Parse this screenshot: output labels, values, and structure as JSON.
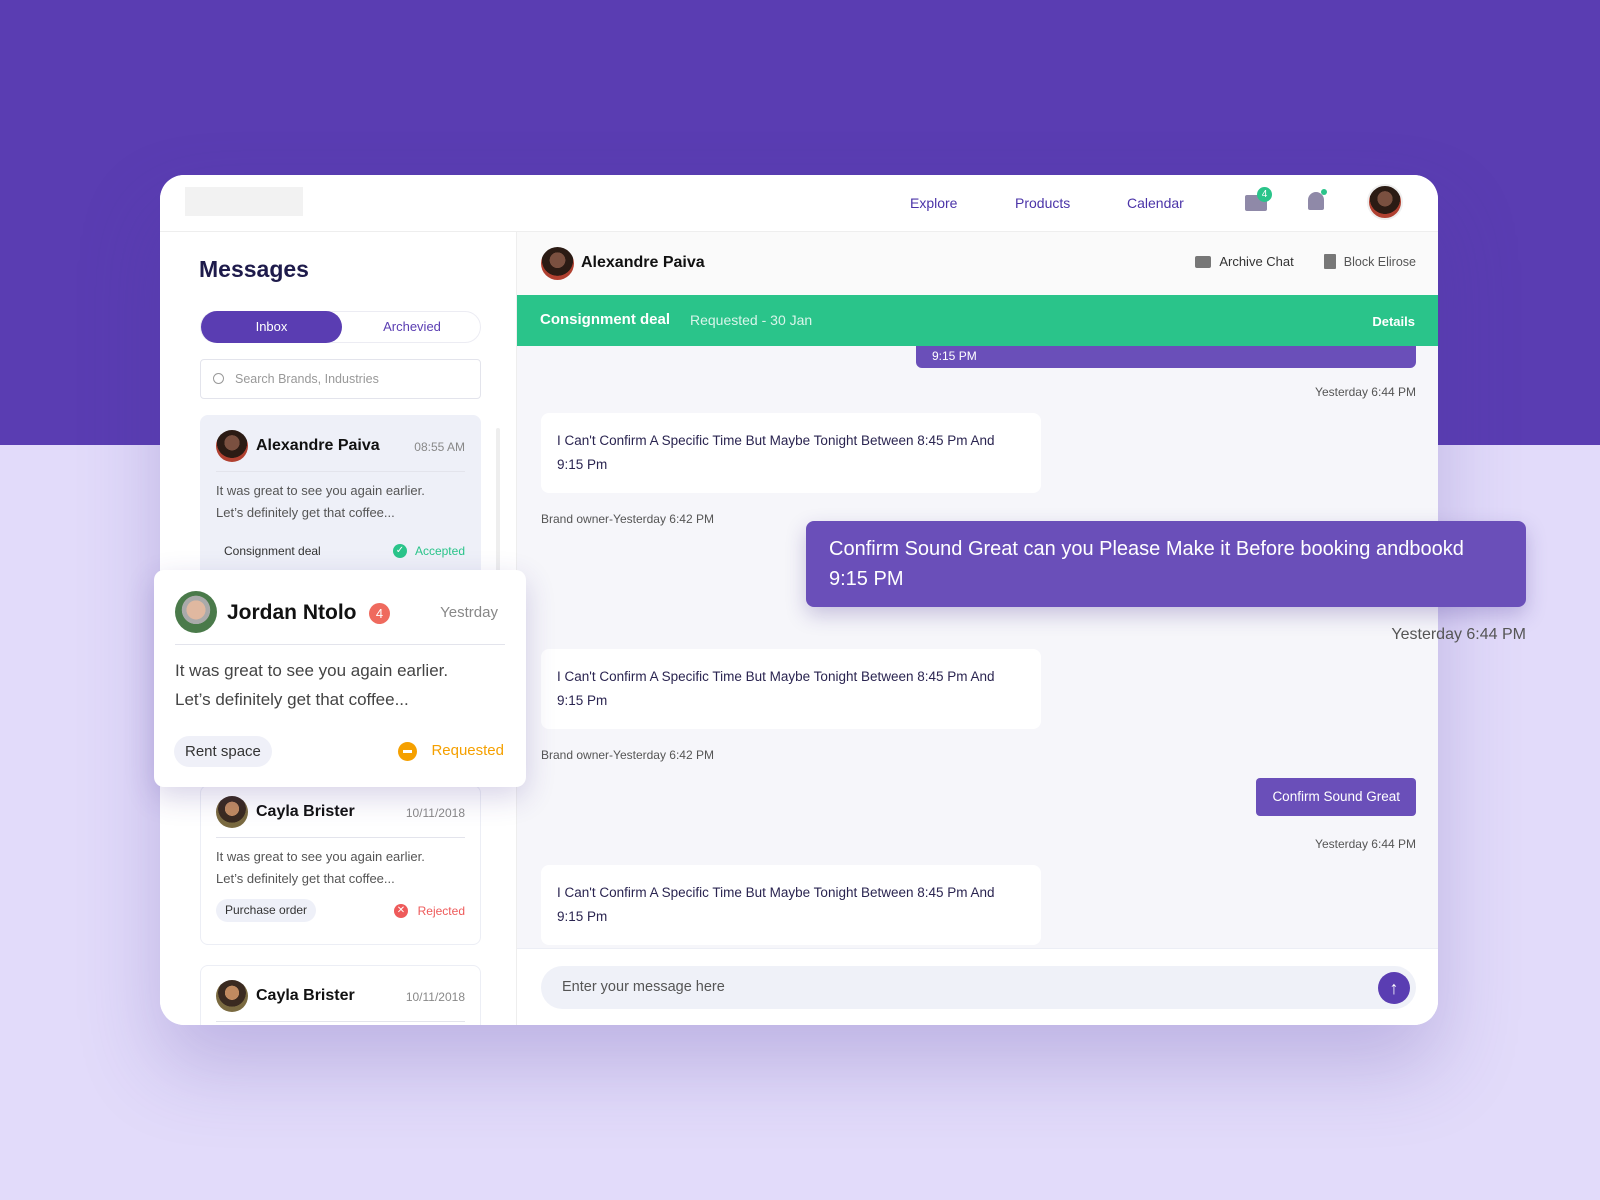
{
  "nav": {
    "links": [
      "Explore",
      "Products",
      "Calendar"
    ],
    "mail_badge": "4"
  },
  "sidebar": {
    "title": "Messages",
    "tabs": [
      "Inbox",
      "Archevied"
    ],
    "search_placeholder": "Search Brands, Industries",
    "items": [
      {
        "name": "Alexandre Paiva",
        "time": "08:55 AM",
        "preview1": "It was great to see you again earlier.",
        "preview2": "Let’s definitely get that coffee...",
        "tag": "Consignment deal",
        "status": "Accepted"
      },
      {
        "name": "Jordan Ntolo",
        "badge": "4",
        "time": "Yestrday",
        "preview1": "It was great to see you again earlier.",
        "preview2": "Let’s definitely get that coffee...",
        "tag": "Rent space",
        "status": "Requested"
      },
      {
        "name": "Cayla Brister",
        "time": "10/11/2018",
        "preview1": "It was great to see you again earlier.",
        "preview2": "Let’s definitely get that coffee...",
        "tag": "Purchase order",
        "status": "Rejected"
      },
      {
        "name": "Cayla Brister",
        "time": "10/11/2018"
      }
    ]
  },
  "chat": {
    "contact": "Alexandre Paiva",
    "archive": "Archive Chat",
    "block": "Block Elirose",
    "deal": {
      "title": "Consignment deal",
      "status": "Requested - 30 Jan",
      "details": "Details"
    },
    "partial_text": "9:15 PM",
    "messages": [
      {
        "dir": "out",
        "time": "Yesterday 6:44 PM"
      },
      {
        "dir": "in",
        "text1": "I Can't Confirm A Specific Time But Maybe Tonight Between  8:45 Pm And",
        "text2": "9:15 Pm",
        "meta": "Brand owner-Yesterday 6:42 PM"
      },
      {
        "dir": "out",
        "text1": "Confirm Sound Great  can you Please Make it Before booking andbookd",
        "text2": "9:15 PM",
        "time": "Yesterday 6:44 PM"
      },
      {
        "dir": "in",
        "text1": "I Can't Confirm A Specific Time But Maybe Tonight Between  8:45 Pm And",
        "text2": "9:15 Pm",
        "meta": "Brand owner-Yesterday 6:42 PM"
      },
      {
        "dir": "out",
        "text1": "Confirm Sound Great",
        "time": "Yesterday 6:44 PM"
      },
      {
        "dir": "in",
        "text1": "I Can't Confirm A Specific Time But Maybe Tonight Between  8:45 Pm And",
        "text2": "9:15 Pm"
      }
    ],
    "input_placeholder": "Enter your message here"
  },
  "colors": {
    "brand": "#5a3db2",
    "accent": "#6a4fb9",
    "green": "#2ac48a",
    "requested": "#f5a000",
    "rejected": "#ee5a5a"
  }
}
